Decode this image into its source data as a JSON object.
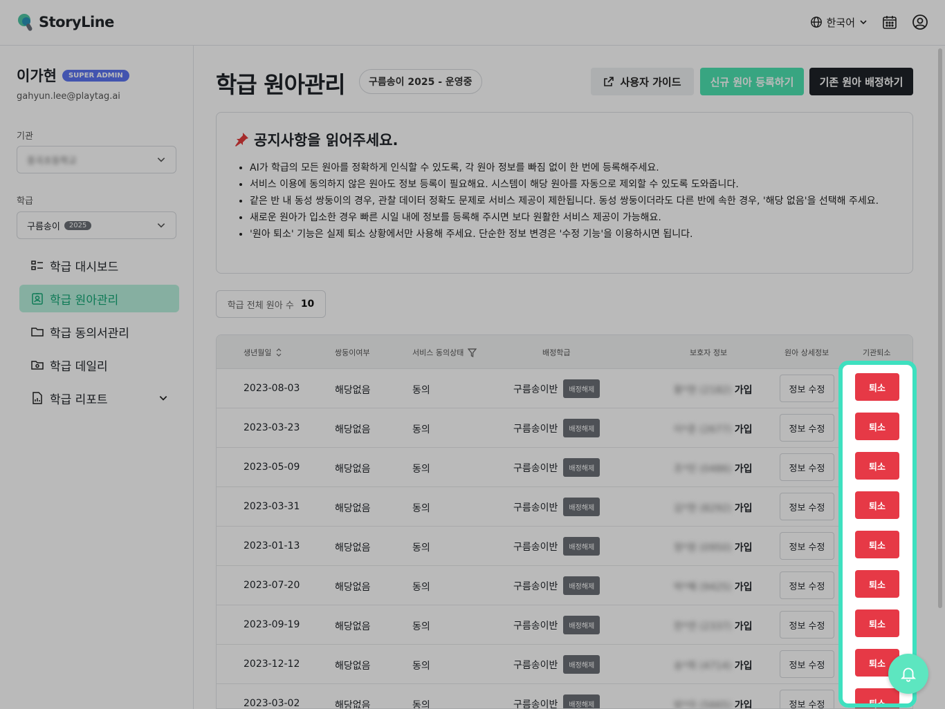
{
  "app": {
    "name": "StoryLine"
  },
  "header": {
    "language": "한국어"
  },
  "user": {
    "name": "이가현",
    "role_badge": "SUPER ADMIN",
    "email": "gahyun.lee@playtag.ai"
  },
  "sidebar": {
    "org_label": "기관",
    "org_value": "중곡초등학교",
    "class_label": "학급",
    "class_value": "구름송이",
    "class_year": "2025",
    "nav": [
      {
        "label": "학급 대시보드"
      },
      {
        "label": "학급 원아관리"
      },
      {
        "label": "학급 동의서관리"
      },
      {
        "label": "학급 데일리"
      },
      {
        "label": "학급 리포트"
      }
    ]
  },
  "main": {
    "title": "학급 원아관리",
    "season": "구름송이 2025 - 운영중",
    "buttons": {
      "guide": "사용자 가이드",
      "new": "신규 원아 등록하기",
      "assign": "기존 원아 배정하기"
    },
    "notice": {
      "title": "공지사항을 읽어주세요.",
      "items": [
        "AI가 학급의 모든 원아를 정확하게 인식할 수 있도록, 각 원아 정보를 빠짐 없이 한 번에 등록해주세요.",
        "서비스 이용에 동의하지 않은 원아도 정보 등록이 필요해요. 시스템이 해당 원아를 자동으로 제외할 수 있도록 도와줍니다.",
        "같은 반 내 동성 쌍둥이의 경우, 관찰 데이터 정확도 문제로 서비스 제공이 제한됩니다. 동성 쌍둥이더라도 다른 반에 속한 경우, '해당 없음'을 선택해 주세요.",
        "새로운 원아가 입소한 경우 빠른 시일 내에 정보를 등록해 주시면 보다 원활한 서비스 제공이 가능해요.",
        "'원아 퇴소' 기능은 실제 퇴소 상황에서만 사용해 주세요. 단순한 정보 변경은 '수정 기능'을 이용하시면 됩니다."
      ]
    },
    "count": {
      "label": "학급 전체 원아 수",
      "value": "10"
    },
    "table": {
      "headers": {
        "dob": "생년월일",
        "twin": "쌍둥이여부",
        "consent": "서비스 동의상태",
        "class": "배정학급",
        "parent": "보호자 정보",
        "detail": "원아 상세정보",
        "leave": "기관퇴소"
      },
      "rows": [
        {
          "dob": "2023-08-03",
          "twin": "해당없음",
          "consent": "동의",
          "class": "구름송이반",
          "unassign": "배정해제",
          "parent_masked": "황*현 (2182)",
          "parent_status": "가입",
          "edit": "정보 수정",
          "leave": "퇴소"
        },
        {
          "dob": "2023-03-23",
          "twin": "해당없음",
          "consent": "동의",
          "class": "구름송이반",
          "unassign": "배정해제",
          "parent_masked": "이*준 (2677)",
          "parent_status": "가입",
          "edit": "정보 수정",
          "leave": "퇴소"
        },
        {
          "dob": "2023-05-09",
          "twin": "해당없음",
          "consent": "동의",
          "class": "구름송이반",
          "unassign": "배정해제",
          "parent_masked": "조*민 (0486)",
          "parent_status": "가입",
          "edit": "정보 수정",
          "leave": "퇴소"
        },
        {
          "dob": "2023-03-31",
          "twin": "해당없음",
          "consent": "동의",
          "class": "구름송이반",
          "unassign": "배정해제",
          "parent_masked": "김*현 (8292)",
          "parent_status": "가입",
          "edit": "정보 수정",
          "leave": "퇴소"
        },
        {
          "dob": "2023-01-13",
          "twin": "해당없음",
          "consent": "동의",
          "class": "구름송이반",
          "unassign": "배정해제",
          "parent_masked": "정*원 (0950)",
          "parent_status": "가입",
          "edit": "정보 수정",
          "leave": "퇴소"
        },
        {
          "dob": "2023-07-20",
          "twin": "해당없음",
          "consent": "동의",
          "class": "구름송이반",
          "unassign": "배정해제",
          "parent_masked": "박*혜 (9425)",
          "parent_status": "가입",
          "edit": "정보 수정",
          "leave": "퇴소"
        },
        {
          "dob": "2023-09-19",
          "twin": "해당없음",
          "consent": "동의",
          "class": "구름송이반",
          "unassign": "배정해제",
          "parent_masked": "한*연 (2337)",
          "parent_status": "가입",
          "edit": "정보 수정",
          "leave": "퇴소"
        },
        {
          "dob": "2023-12-12",
          "twin": "해당없음",
          "consent": "동의",
          "class": "구름송이반",
          "unassign": "배정해제",
          "parent_masked": "송*희 (4714)",
          "parent_status": "가입",
          "edit": "정보 수정",
          "leave": "퇴소"
        },
        {
          "dob": "2023-03-02",
          "twin": "해당없음",
          "consent": "동의",
          "class": "구름송이반",
          "unassign": "배정해제",
          "parent_masked": "방*아 (5665)",
          "parent_status": "가입",
          "edit": "정보 수정",
          "leave": "퇴소"
        }
      ]
    }
  },
  "colors": {
    "accent": "#4ee3b1",
    "danger": "#e63946",
    "highlight": "#3ee0bf",
    "admin_badge": "#5b74f0"
  }
}
